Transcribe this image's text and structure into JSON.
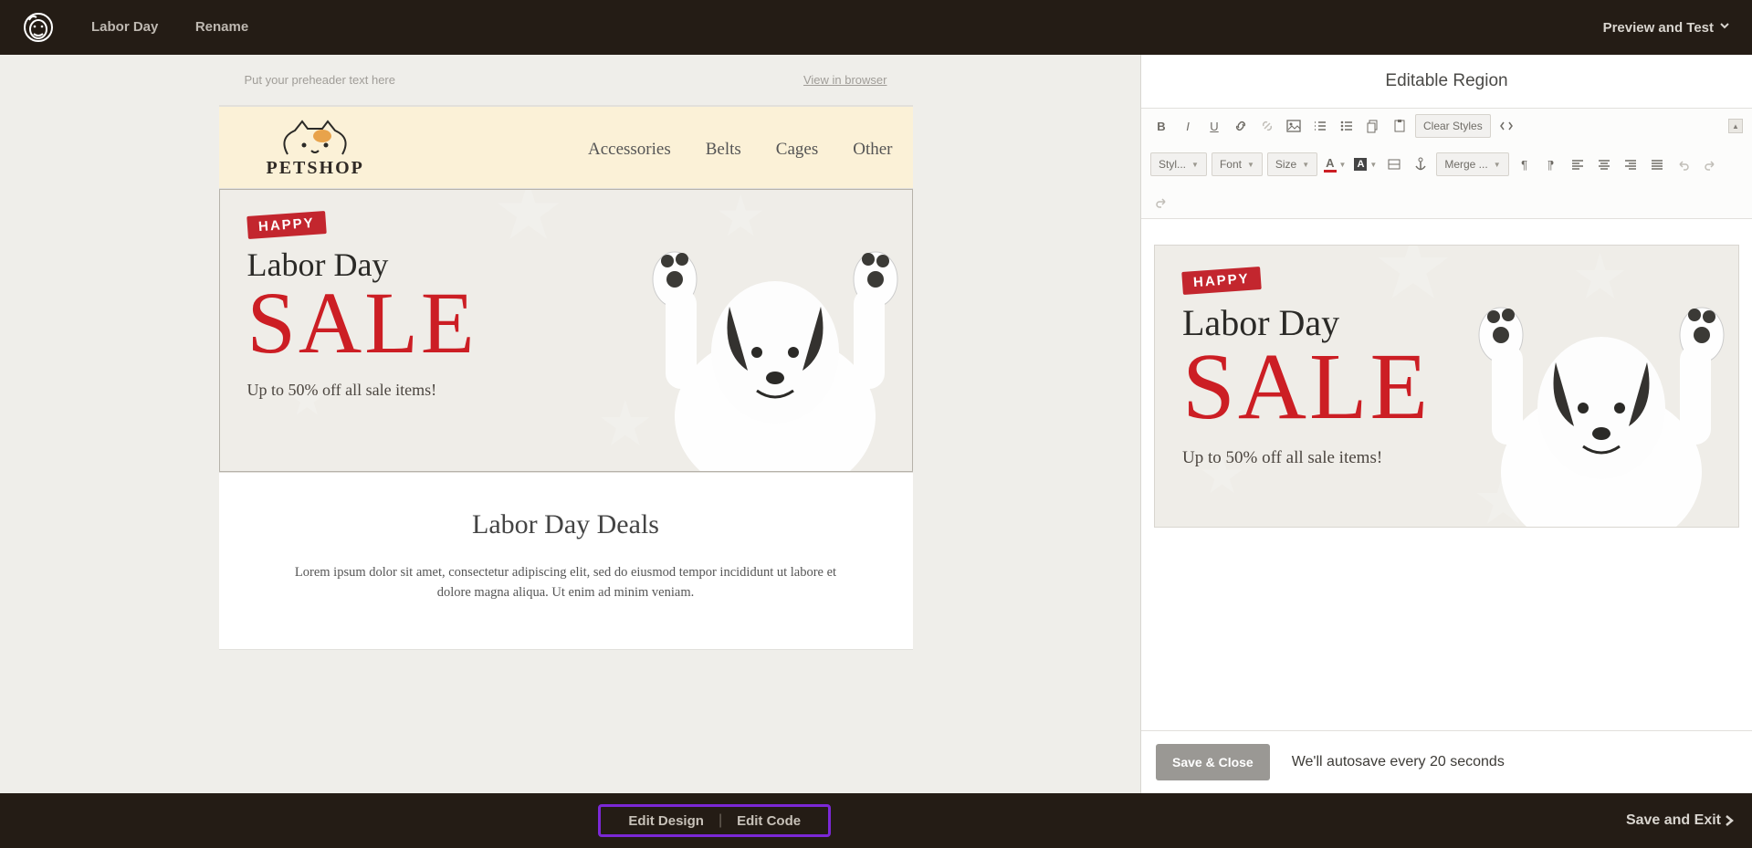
{
  "topbar": {
    "campaign_name": "Labor Day",
    "rename_label": "Rename",
    "preview_label": "Preview and Test"
  },
  "preview": {
    "preheader_placeholder": "Put your preheader text here",
    "view_in_browser": "View in browser",
    "brand_name": "PETSHOP",
    "nav": [
      "Accessories",
      "Belts",
      "Cages",
      "Other"
    ],
    "ribbon": "HAPPY",
    "cursive": "Labor Day",
    "sale_text": "SALE",
    "offer": "Up to 50% off all sale items!",
    "section_heading": "Labor Day Deals",
    "section_text": "Lorem ipsum dolor sit amet, consectetur adipiscing elit, sed do eiusmod tempor incididunt ut labore et dolore magna aliqua. Ut enim ad minim veniam."
  },
  "editor": {
    "title": "Editable Region",
    "toolbar": {
      "styles_drop": "Styl...",
      "font_drop": "Font",
      "size_drop": "Size",
      "merge_drop": "Merge ...",
      "clear_styles": "Clear Styles"
    },
    "save_close": "Save & Close",
    "autosave_text": "We'll autosave every 20 seconds"
  },
  "bottombar": {
    "edit_design": "Edit Design",
    "edit_code": "Edit Code",
    "save_exit": "Save and Exit"
  }
}
